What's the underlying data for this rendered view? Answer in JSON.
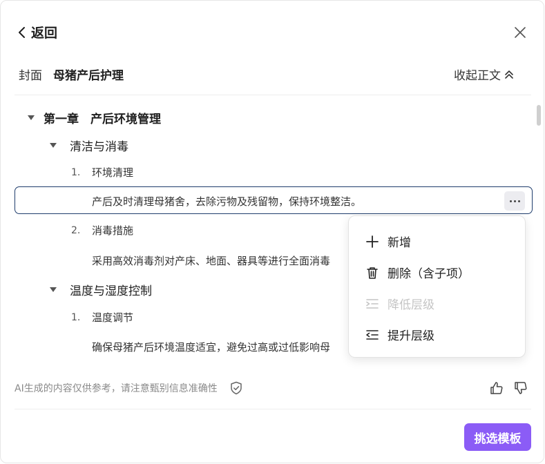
{
  "header": {
    "back_label": "返回"
  },
  "breadcrumb": {
    "cover": "封面",
    "title": "母猪产后护理",
    "collapse_label": "收起正文"
  },
  "outline": {
    "chapter": "第一章　产后环境管理",
    "section1": {
      "title": "清洁与消毒",
      "item1": {
        "num": "1.",
        "title": "环境清理",
        "body": "产后及时清理母猪舍，去除污物及残留物，保持环境整洁。"
      },
      "item2": {
        "num": "2.",
        "title": "消毒措施",
        "body": "采用高效消毒剂对产床、地面、器具等进行全面消毒"
      }
    },
    "section2": {
      "title": "温度与湿度控制",
      "item1": {
        "num": "1.",
        "title": "温度调节",
        "body": "确保母猪产后环境温度适宜，避免过高或过低影响母"
      }
    }
  },
  "context_menu": {
    "add": "新增",
    "delete": "删除（含子项）",
    "demote": "降低层级",
    "promote": "提升层级"
  },
  "footer": {
    "disclaimer": "AI生成的内容仅供参考，请注意甄别信息准确性",
    "primary_button": "挑选模板"
  },
  "colors": {
    "accent": "#8b5cf6",
    "selection_border": "#1d3b6b"
  }
}
